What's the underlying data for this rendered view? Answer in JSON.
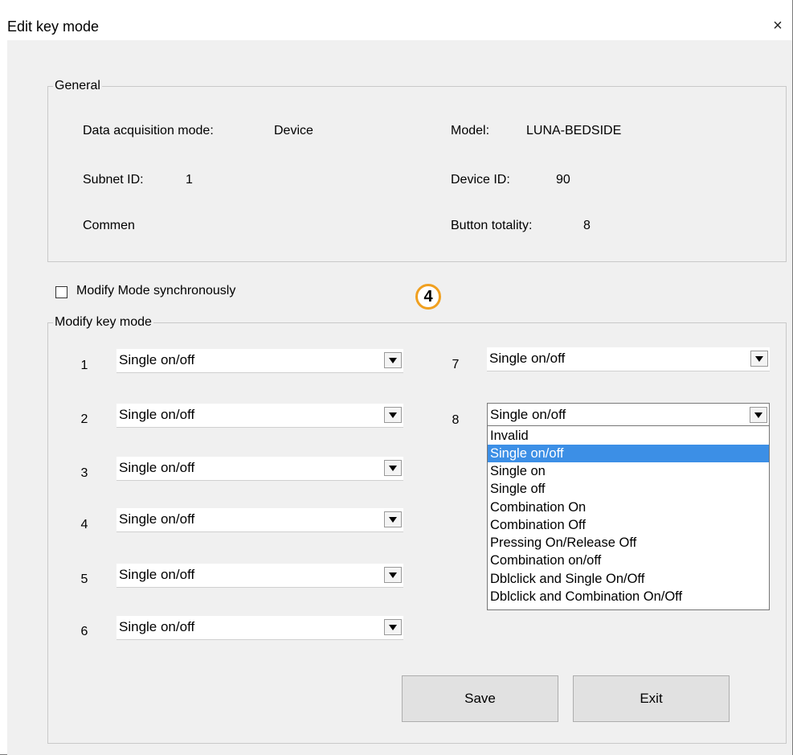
{
  "window": {
    "title": "Edit key mode",
    "close_glyph": "×"
  },
  "general": {
    "legend": "General",
    "data_acquisition_label": "Data acquisition mode:",
    "data_acquisition_value": "Device",
    "model_label": "Model:",
    "model_value": "LUNA-BEDSIDE",
    "subnet_label": "Subnet ID:",
    "subnet_value": "1",
    "device_label": "Device ID:",
    "device_value": "90",
    "commen_label": "Commen",
    "button_totality_label": "Button totality:",
    "button_totality_value": "8"
  },
  "sync_checkbox": {
    "label": "Modify Mode synchronously",
    "checked": false
  },
  "annotation_badge": "4",
  "modify": {
    "legend": "Modify key mode",
    "keys": [
      {
        "num": "1",
        "value": "Single on/off"
      },
      {
        "num": "2",
        "value": "Single on/off"
      },
      {
        "num": "3",
        "value": "Single on/off"
      },
      {
        "num": "4",
        "value": "Single on/off"
      },
      {
        "num": "5",
        "value": "Single on/off"
      },
      {
        "num": "6",
        "value": "Single on/off"
      },
      {
        "num": "7",
        "value": "Single on/off"
      },
      {
        "num": "8",
        "value": "Single on/off"
      }
    ]
  },
  "dropdown": {
    "options": [
      "Invalid",
      "Single on/off",
      "Single on",
      "Single off",
      "Combination On",
      "Combination Off",
      "Pressing On/Release Off",
      "Combination on/off",
      "Dblclick and Single On/Off",
      "Dblclick and Combination On/Off"
    ],
    "selected_index": 1
  },
  "buttons": {
    "save": "Save",
    "exit": "Exit"
  },
  "colors": {
    "highlight": "#3c8fe6",
    "badge_ring": "#f0a020",
    "client_bg": "#f0f0f0"
  }
}
